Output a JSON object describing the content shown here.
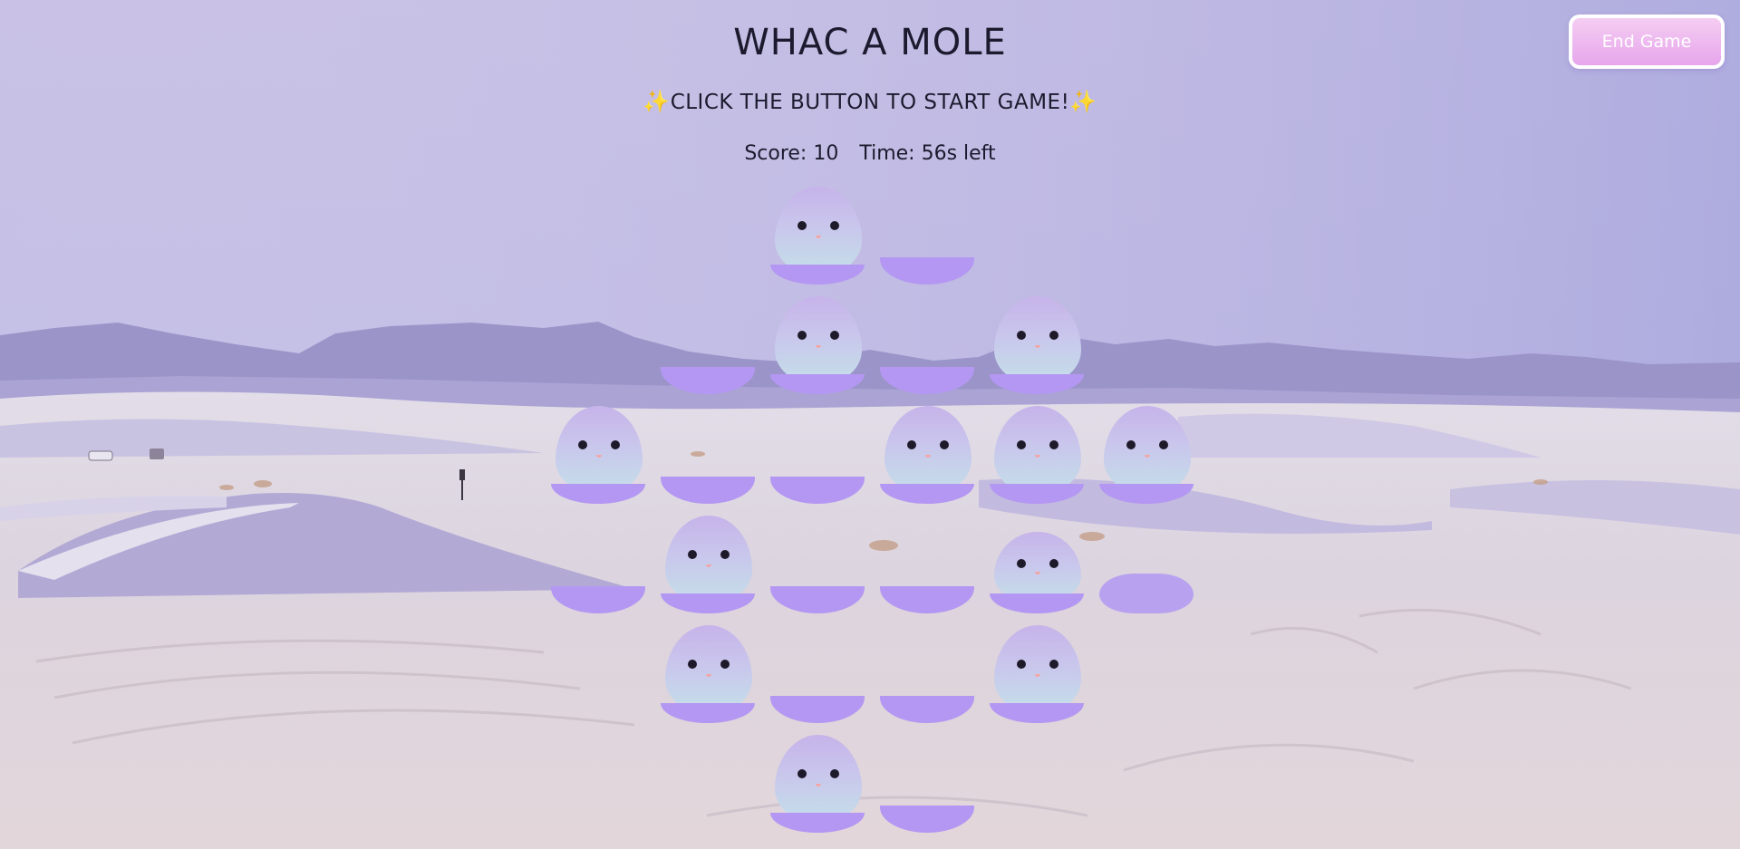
{
  "game": {
    "title": "WHAC A MOLE",
    "subtitle_prefix": "✨",
    "subtitle": "CLICK THE BUTTON TO START GAME!",
    "subtitle_suffix": "✨",
    "score_label": "Score: 10",
    "time_label": "Time: 56s left",
    "end_button": "End Game"
  },
  "colors": {
    "sky_top": "#a9a7dc",
    "mole_top": "#c6b3ea",
    "mole_bottom": "#c4dfe9",
    "hole_rim": "#b497f2",
    "button": "#eab0ee"
  },
  "board": {
    "holes": [
      {
        "row": 0,
        "col": 2,
        "mole": true
      },
      {
        "row": 0,
        "col": 3,
        "mole": false
      },
      {
        "row": 1,
        "col": 1,
        "mole": false
      },
      {
        "row": 1,
        "col": 2,
        "mole": true
      },
      {
        "row": 1,
        "col": 3,
        "mole": false
      },
      {
        "row": 1,
        "col": 4,
        "mole": true
      },
      {
        "row": 2,
        "col": 0,
        "mole": true
      },
      {
        "row": 2,
        "col": 1,
        "mole": false
      },
      {
        "row": 2,
        "col": 2,
        "mole": false
      },
      {
        "row": 2,
        "col": 3,
        "mole": true
      },
      {
        "row": 2,
        "col": 4,
        "mole": true
      },
      {
        "row": 2,
        "col": 5,
        "mole": true
      },
      {
        "row": 3,
        "col": 0,
        "mole": false
      },
      {
        "row": 3,
        "col": 1,
        "mole": true
      },
      {
        "row": 3,
        "col": 2,
        "mole": false
      },
      {
        "row": 3,
        "col": 3,
        "mole": false
      },
      {
        "row": 3,
        "col": 4,
        "mole": true,
        "rising": true
      },
      {
        "row": 3,
        "col": 5,
        "mole": false,
        "lump": true
      },
      {
        "row": 4,
        "col": 1,
        "mole": true
      },
      {
        "row": 4,
        "col": 2,
        "mole": false
      },
      {
        "row": 4,
        "col": 3,
        "mole": false
      },
      {
        "row": 4,
        "col": 4,
        "mole": true
      },
      {
        "row": 5,
        "col": 2,
        "mole": true
      },
      {
        "row": 5,
        "col": 3,
        "mole": false
      }
    ]
  }
}
